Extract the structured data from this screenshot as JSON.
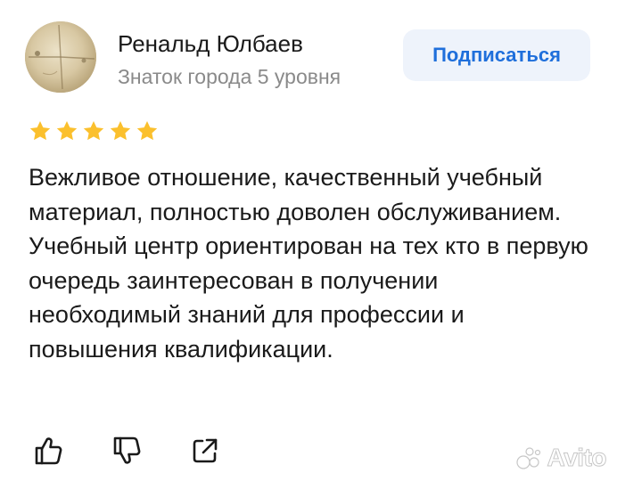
{
  "author": {
    "name": "Ренальд Юлбаев",
    "level": "Знаток города 5 уровня"
  },
  "subscribe_button": {
    "label": "Подписаться"
  },
  "rating": {
    "value": 5,
    "max": 5,
    "star_color": "#fbc02d"
  },
  "review": {
    "text": "Вежливое отношение, качественный учебный материал, полностью доволен обслуживанием. Учебный центр ориентирован на тех кто в первую очередь заинтересован в получении необходимый знаний для профессии и повышения квалификации."
  },
  "actions": [
    {
      "name": "like",
      "icon": "thumbs-up-icon"
    },
    {
      "name": "dislike",
      "icon": "thumbs-down-icon"
    },
    {
      "name": "share",
      "icon": "share-icon"
    }
  ],
  "watermark": {
    "text": "Avito"
  },
  "colors": {
    "accent": "#1f6fdb",
    "button_bg": "#eef3fb",
    "secondary_text": "#8a8a8a"
  }
}
